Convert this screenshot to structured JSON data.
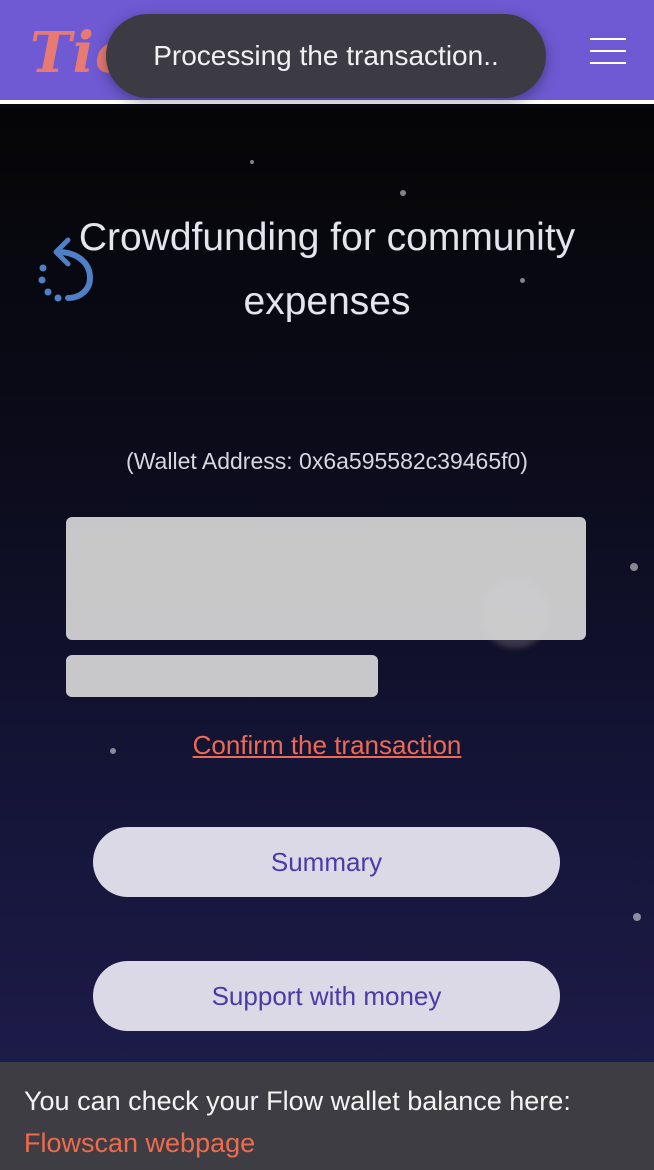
{
  "header": {
    "logo_text": "Tickets",
    "toast_text": "Processing the transaction.."
  },
  "main": {
    "title": "Crowdfunding for community expenses",
    "wallet_address": "(Wallet Address: 0x6a595582c39465f0)",
    "confirm_link": "Confirm the transaction",
    "summary_button": "Summary",
    "support_button": "Support with money"
  },
  "footer": {
    "text": "You can check your Flow wallet balance here:",
    "link": "Flowscan webpage"
  },
  "icons": {
    "refresh": "refresh-icon",
    "menu": "hamburger-menu-icon"
  },
  "colors": {
    "header_bg": "#6f5ad3",
    "accent_link": "#ee6a52",
    "button_text": "#4a3aa6",
    "button_bg": "#dcd9e7",
    "footer_bg": "#3e3d44",
    "logo": "#e77a73"
  }
}
